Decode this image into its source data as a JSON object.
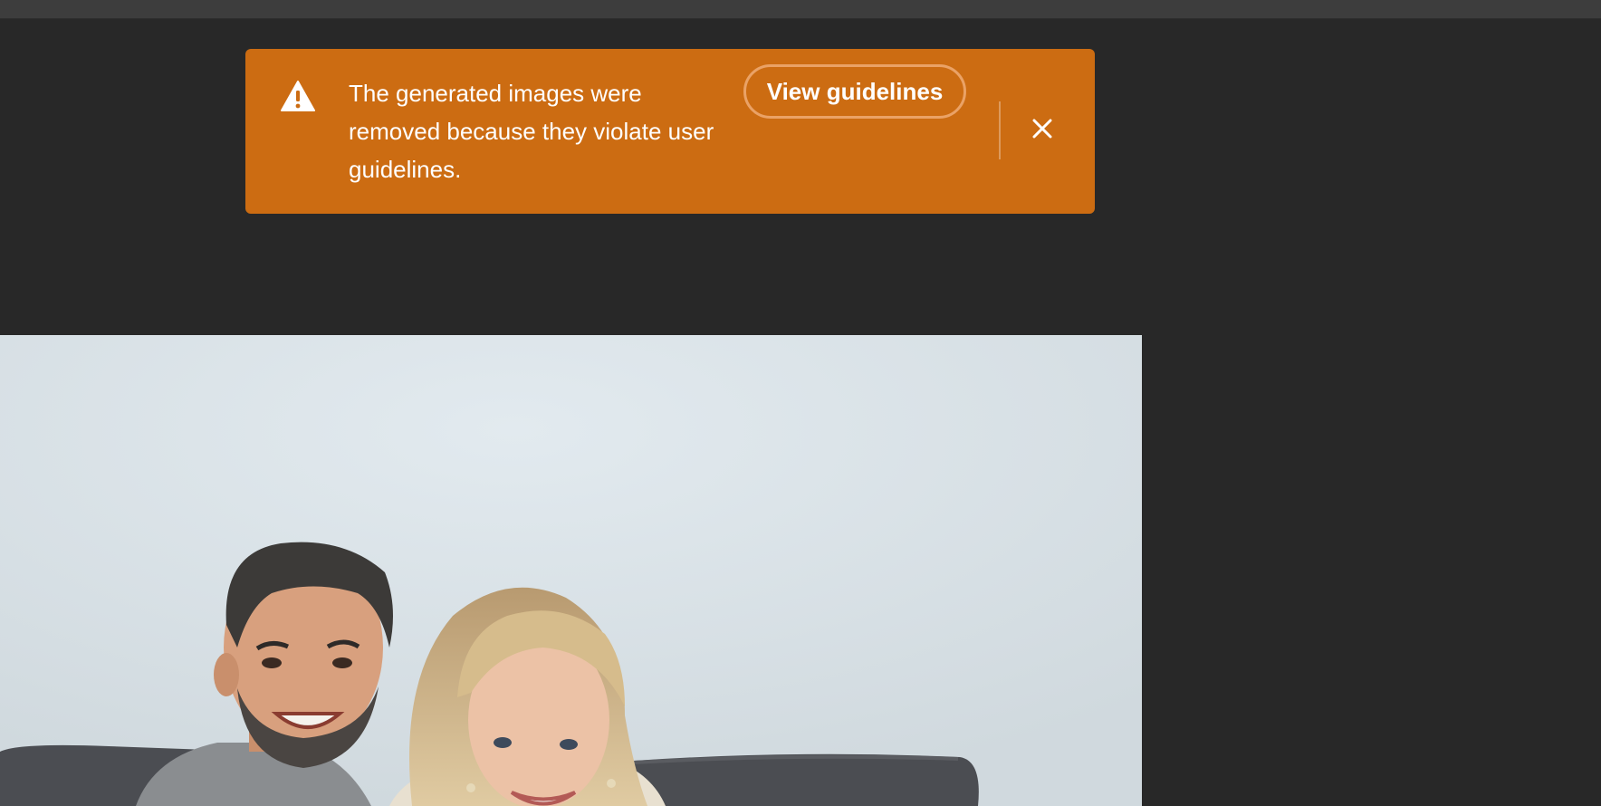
{
  "toast": {
    "message": "The generated images were removed because they violate user guidelines.",
    "button_label": "View guidelines",
    "alert_icon": "alert-triangle-icon",
    "close_icon": "close-icon",
    "background_color": "#cc6c12"
  },
  "canvas": {
    "background_color": "#282828"
  }
}
